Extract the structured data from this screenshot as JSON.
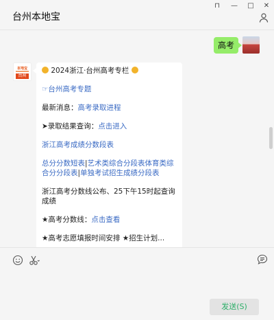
{
  "window": {
    "title": "台州本地宝",
    "controls": {
      "pin": "⊓",
      "minimize": "—",
      "maximize": "□",
      "close": "✕"
    }
  },
  "messages": {
    "outgoing": {
      "text": "高考"
    },
    "incoming": {
      "logo_text": "本地宝",
      "logo_badge": "台州",
      "lines": {
        "l1": "2024浙江·台州高考专栏",
        "l2_prefix": "☞",
        "l2_link": "台州高考专题",
        "l3_prefix": "最新消息：",
        "l3_link": "高考录取进程",
        "l4_prefix": "➤录取结果查询：",
        "l4_link": "点击进入",
        "l5_link": "浙江高考成绩分数段表",
        "l6a": "总分分数短表",
        "l6sep": "|",
        "l6b": "艺术类综合分段表",
        "l6c": "体育类综合分分段表",
        "l6d": "单独考试招生成绩分段表",
        "l7": "浙江高考分数线公布、25下午15时起查询成绩",
        "l8_prefix": "★高考分数线：",
        "l8_link": "点击查看",
        "l9": "★高考志愿填报时间安排 ★招生计划..."
      }
    }
  },
  "input": {
    "icons": [
      "emoji-icon",
      "scissors-icon",
      "chat-history-icon"
    ],
    "send_label": "发送(S)"
  },
  "colors": {
    "bubble_out": "#95ec69",
    "link": "#3b6bc4",
    "send_text": "#2aae67"
  }
}
